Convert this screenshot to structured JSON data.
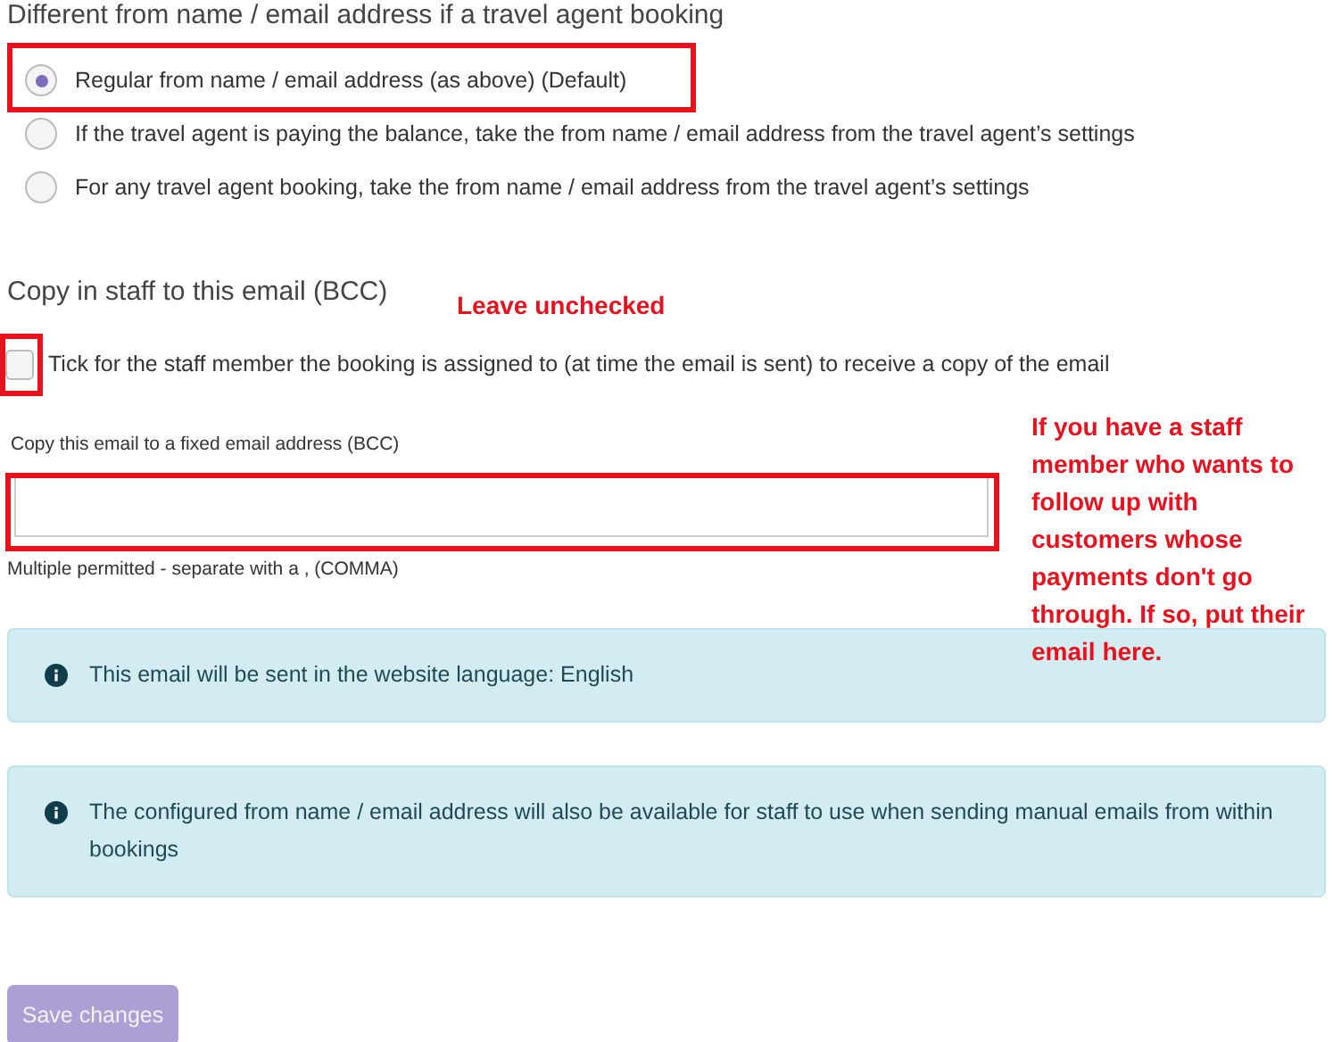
{
  "from_section": {
    "heading": "Different from name / email address if a travel agent booking",
    "options": [
      {
        "label": "Regular from name / email address (as above) (Default)",
        "selected": true
      },
      {
        "label": "If the travel agent is paying the balance, take the from name / email address from the travel agent’s settings",
        "selected": false
      },
      {
        "label": "For any travel agent booking, take the from name / email address from the travel agent’s settings",
        "selected": false
      }
    ]
  },
  "bcc_section": {
    "heading": "Copy in staff to this email (BCC)",
    "staff_checkbox": {
      "label": "Tick for the staff member the booking is assigned to (at time the email is sent) to receive a copy of the email",
      "checked": false
    },
    "fixed_field": {
      "label": "Copy this email to a fixed email address (BCC)",
      "help": "Multiple permitted - separate with a , (COMMA)"
    }
  },
  "info_notes": [
    "This email will be sent in the website language: English",
    "The configured from name / email address will also be available for staff to use when sending manual emails from within bookings"
  ],
  "save_button": {
    "label": "Save changes",
    "disabled": true
  },
  "annotations": {
    "checkbox_note": "Leave unchecked",
    "field_note": "If you have a staff member who wants to follow up with customers whose payments don't go through. If so, put their email here."
  }
}
